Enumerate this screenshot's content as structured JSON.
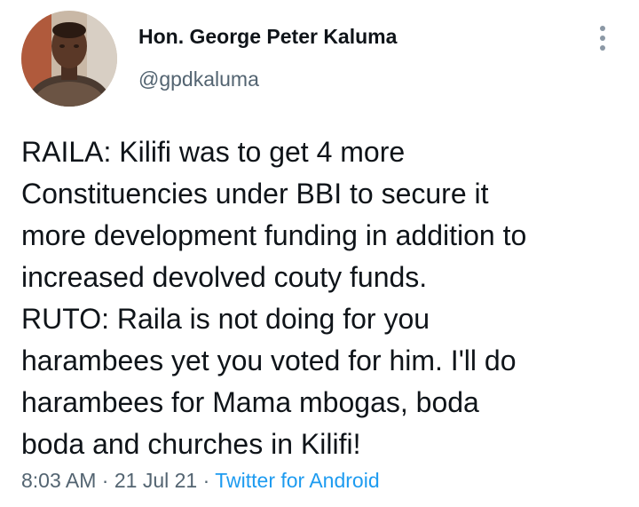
{
  "author": {
    "display_name": "Hon. George Peter Kaluma",
    "handle": "@gpdkaluma",
    "avatar_icon": "profile-photo-avatar"
  },
  "menu": {
    "icon": "more-vertical-icon"
  },
  "tweet": {
    "lines": [
      "RAILA: Kilifi was to get 4 more",
      "Constituencies under BBI to secure it",
      "more development funding in addition to",
      "increased devolved couty funds.",
      "RUTO: Raila is not doing for you",
      "harambees yet you voted for him. I'll do",
      "harambees for Mama mbogas, boda",
      "boda and churches in Kilifi!"
    ]
  },
  "meta": {
    "time": "8:03 AM",
    "separator": "·",
    "date": "21 Jul 21",
    "source": "Twitter for Android"
  },
  "colors": {
    "text": "#0f1419",
    "secondary": "#536471",
    "link": "#1d9bf0"
  }
}
